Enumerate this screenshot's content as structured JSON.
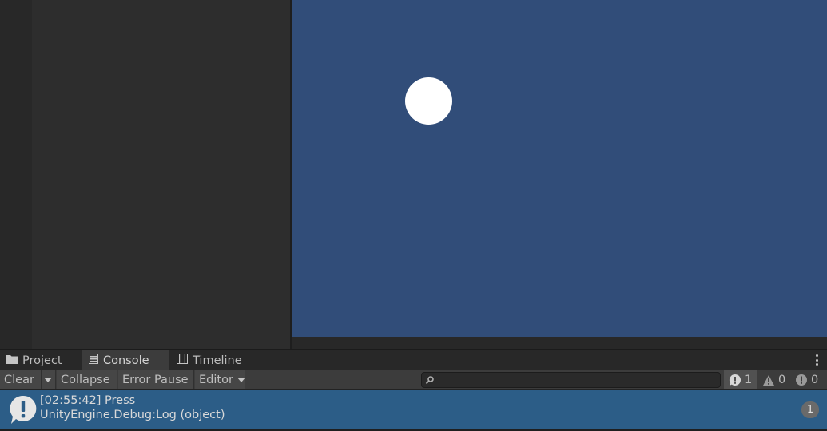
{
  "tabs": [
    {
      "label": "Project",
      "icon": "folder-icon"
    },
    {
      "label": "Console",
      "icon": "console-icon",
      "active": true
    },
    {
      "label": "Timeline",
      "icon": "timeline-icon"
    }
  ],
  "toolbar": {
    "clear_label": "Clear",
    "collapse_label": "Collapse",
    "error_pause_label": "Error Pause",
    "editor_label": "Editor",
    "search_placeholder": "",
    "counts": {
      "log": "1",
      "warning": "0",
      "error": "0"
    }
  },
  "log_entries": [
    {
      "time_message": "[02:55:42] Press",
      "source": "UnityEngine.Debug:Log (object)",
      "count": "1"
    }
  ],
  "colors": {
    "scene_background": "#314d79",
    "selected_row": "#2c5d87",
    "panel": "#282828"
  }
}
